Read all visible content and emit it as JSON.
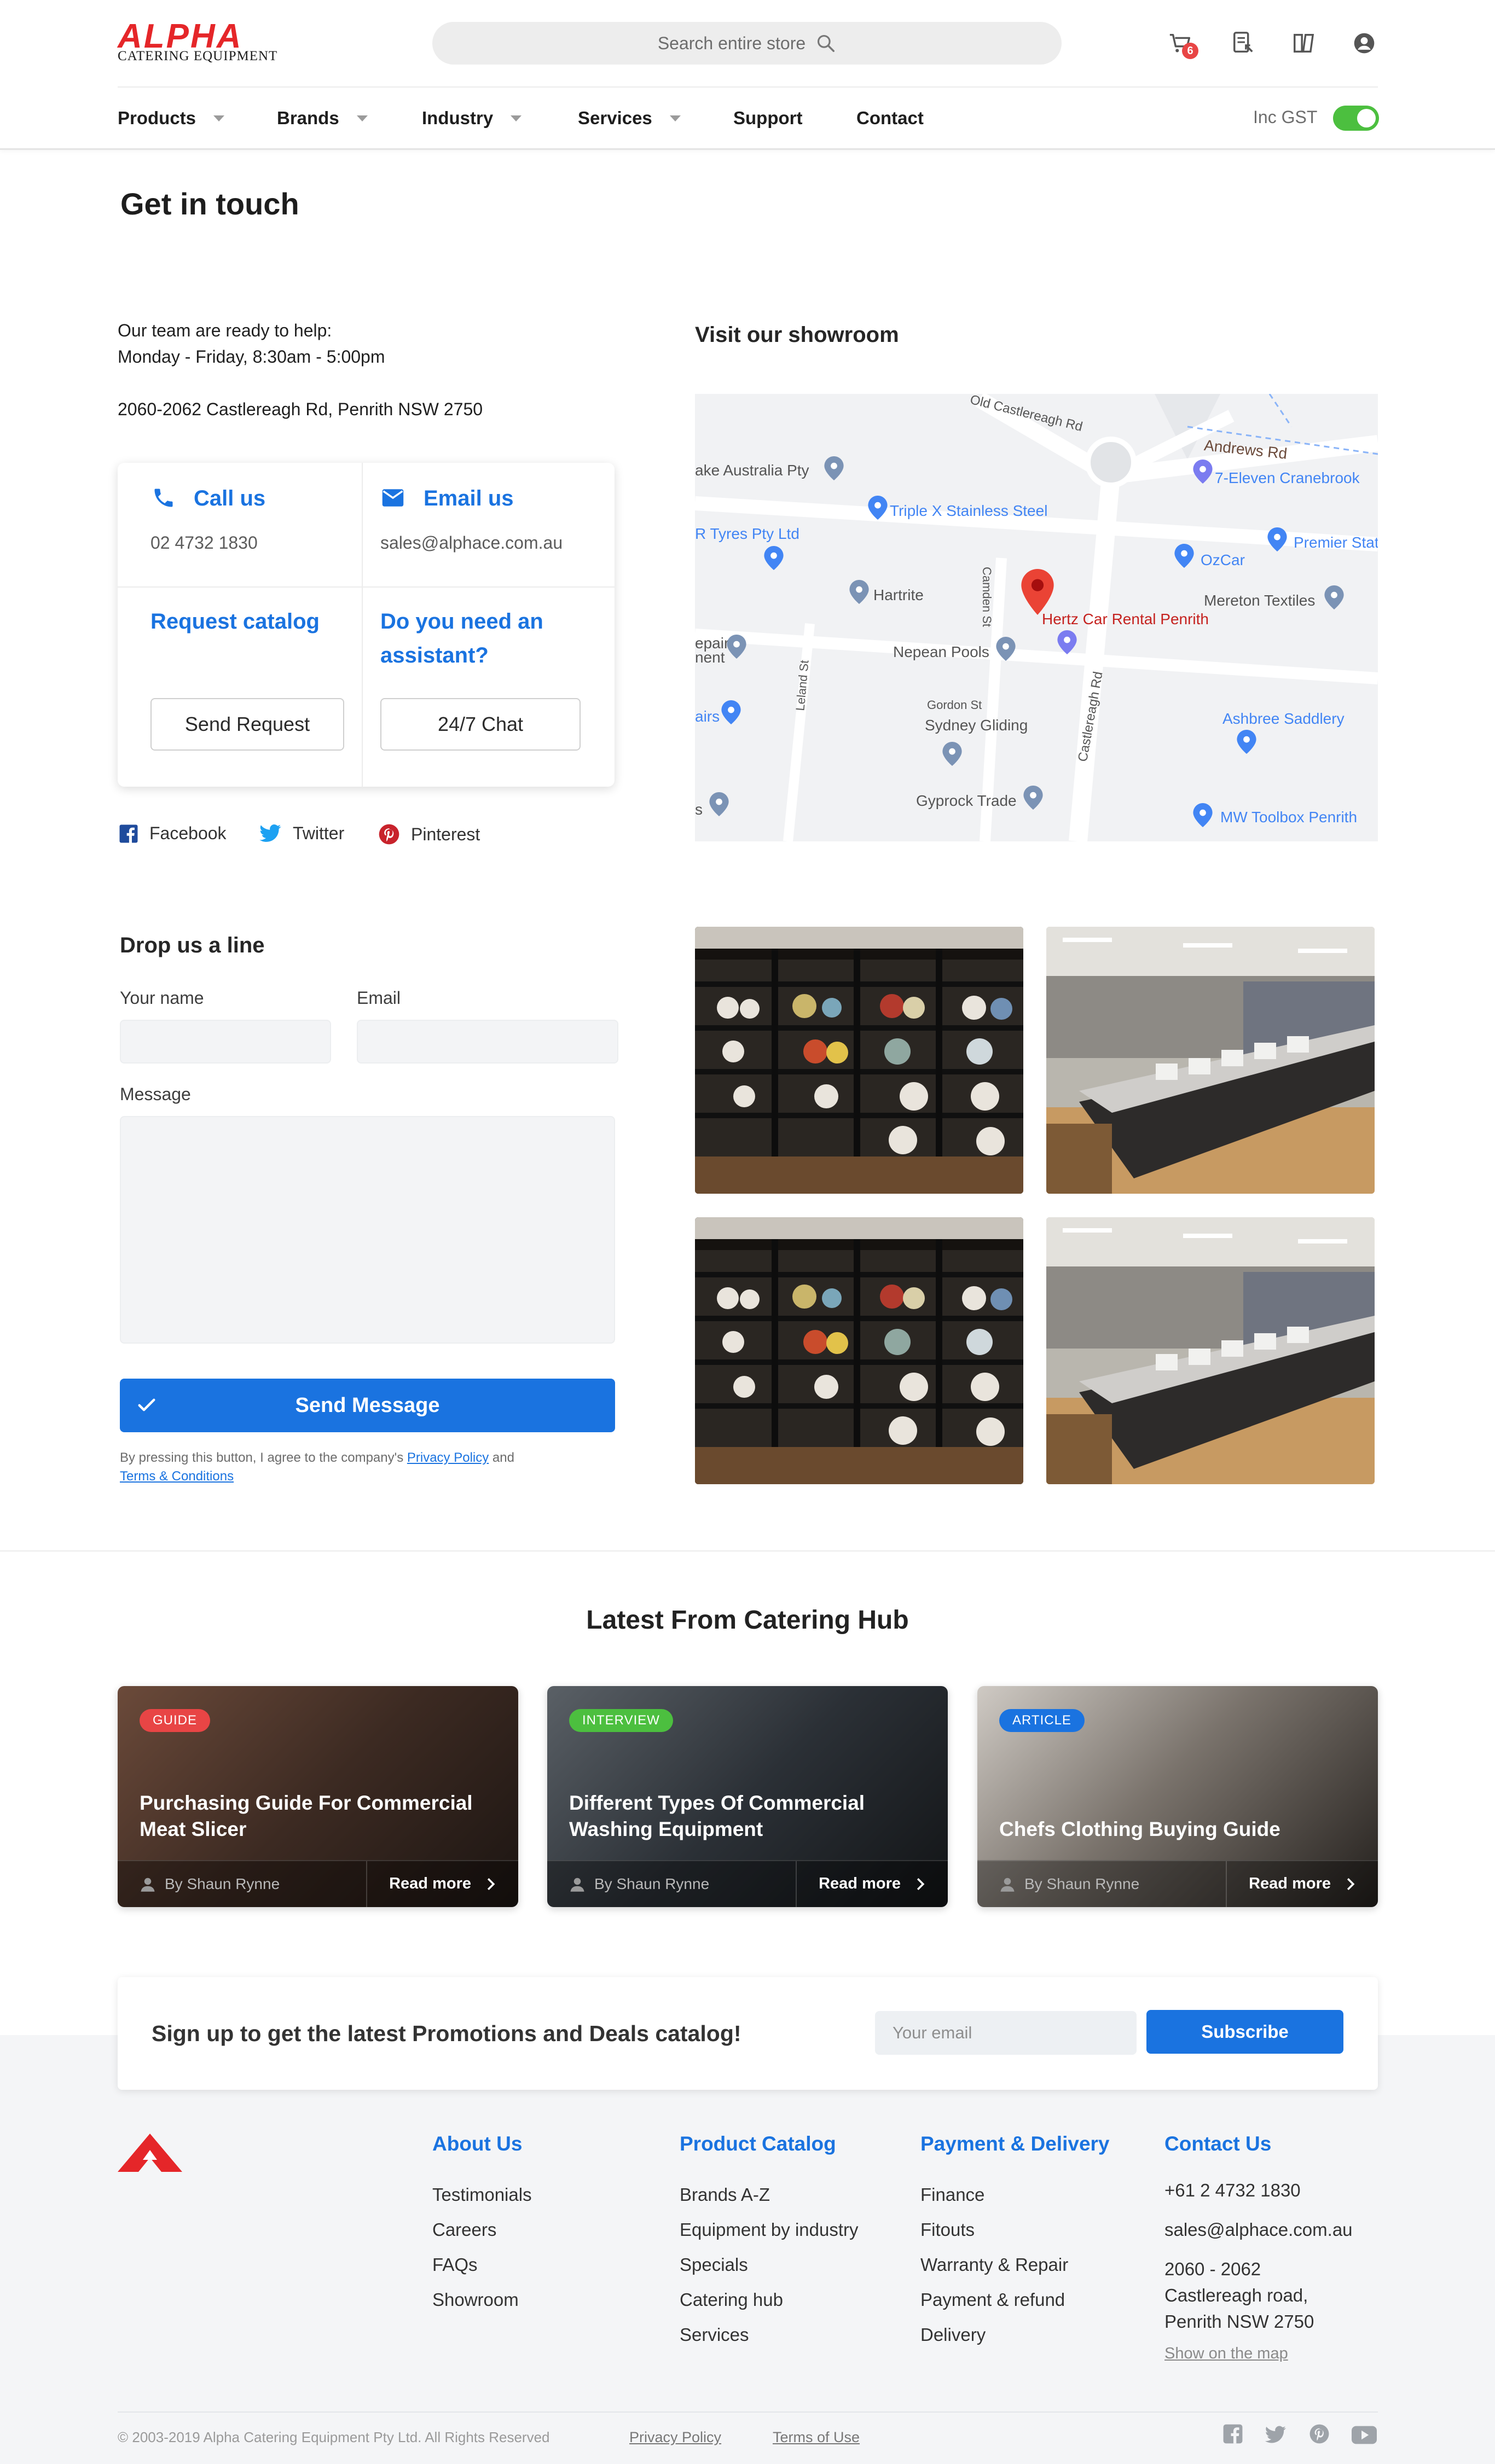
{
  "header": {
    "logo_word": "ALPHA",
    "logo_sub": "CATERING EQUIPMENT",
    "search_placeholder": "Search entire store",
    "cart_count": "6",
    "nav": [
      "Products",
      "Brands",
      "Industry",
      "Services",
      "Support",
      "Contact"
    ],
    "gst_label": "Inc GST",
    "gst_on": true
  },
  "contact": {
    "page_title": "Get in touch",
    "help_line1": "Our team are ready to help:",
    "help_line2": "Monday - Friday, 8:30am - 5:00pm",
    "address": "2060-2062 Castlereagh Rd, Penrith NSW 2750",
    "call_title": "Call us",
    "call_value": "02 4732 1830",
    "email_title": "Email us",
    "email_value": "sales@alphace.com.au",
    "catalog_title": "Request catalog",
    "catalog_button": "Send Request",
    "assistant_title_l1": "Do you need an",
    "assistant_title_l2": "assistant?",
    "assistant_button": "24/7 Chat",
    "social": [
      "Facebook",
      "Twitter",
      "Pinterest"
    ]
  },
  "showroom": {
    "title": "Visit our showroom",
    "map_labels": {
      "old_castlereagh": "Old Castlereagh Rd",
      "andrews": "Andrews Rd",
      "seven_eleven": "7-Eleven Cranebrook",
      "australia_pty": "ake Australia Pty",
      "triple_x": "Triple X Stainless Steel",
      "tyres": "R Tyres Pty Ltd",
      "ozcar": "OzCar",
      "premier": "Premier Stat",
      "hartrite": "Hartrite",
      "camden": "Camden St",
      "hertz": "Hertz Car Rental Penrith",
      "mereton": "Mereton Textiles",
      "repair": "epair",
      "repair2": "nent",
      "nepean": "Nepean Pools",
      "leland": "Leland St",
      "castlereagh": "Castlereagh Rd",
      "gordon": "Gordon St",
      "sydney_gliding": "Sydney Gliding",
      "airs": "airs",
      "ashbree": "Ashbree Saddlery",
      "s": "s",
      "gyprock": "Gyprock Trade",
      "mw": "MW Toolbox Penrith"
    }
  },
  "form": {
    "title": "Drop us a line",
    "name_label": "Your name",
    "email_label": "Email",
    "message_label": "Message",
    "submit": "Send Message",
    "legal_prefix": "By pressing this button, I agree to the company's ",
    "privacy": "Privacy Policy",
    "and": " and ",
    "terms": "Terms & Conditions"
  },
  "hub": {
    "title": "Latest From Catering Hub",
    "posts": [
      {
        "badge": "GUIDE",
        "badge_color": "#e84545",
        "title": "Purchasing Guide For Commercial Meat Slicer",
        "author": "By Shaun Rynne",
        "read_more": "Read more"
      },
      {
        "badge": "INTERVIEW",
        "badge_color": "#4cbf3f",
        "title": "Different Types Of Commercial Washing Equipment",
        "author": "By Shaun Rynne",
        "read_more": "Read more"
      },
      {
        "badge": "ARTICLE",
        "badge_color": "#1a73e0",
        "title": "Chefs Clothing Buying Guide",
        "author": "By Shaun Rynne",
        "read_more": "Read more"
      }
    ]
  },
  "newsletter": {
    "text": "Sign up to get the latest Promotions and Deals catalog!",
    "placeholder": "Your email",
    "button": "Subscribe"
  },
  "footer": {
    "about": {
      "title": "About Us",
      "links": [
        "Testimonials",
        "Careers",
        "FAQs",
        "Showroom"
      ]
    },
    "catalog": {
      "title": "Product Catalog",
      "links": [
        "Brands A-Z",
        "Equipment by industry",
        "Specials",
        "Catering hub",
        "Services"
      ]
    },
    "payment": {
      "title": "Payment & Delivery",
      "links": [
        "Finance",
        "Fitouts",
        "Warranty & Repair",
        "Payment & refund",
        "Delivery"
      ]
    },
    "contact": {
      "title": "Contact Us",
      "phone": "+61 2 4732 1830",
      "email": "sales@alphace.com.au",
      "addr1": "2060 - 2062",
      "addr2": "Castlereagh road,",
      "addr3": "Penrith NSW 2750",
      "map_link": "Show on the map"
    },
    "copyright": "© 2003-2019 Alpha Catering Equipment Pty Ltd. All Rights Reserved",
    "privacy": "Privacy Policy",
    "terms": "Terms of Use"
  },
  "colors": {
    "brand_red": "#e52629",
    "accent_blue": "#1a73e0",
    "toggle_green": "#4cbf3f"
  }
}
